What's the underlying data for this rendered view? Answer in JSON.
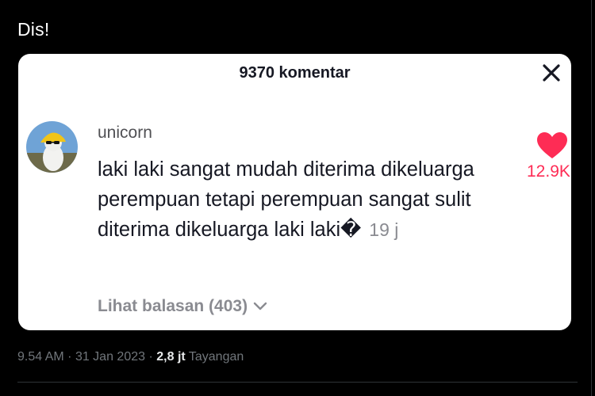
{
  "tweet": {
    "text": "Dis!",
    "time": "9.54 AM",
    "sep1": "·",
    "date": "31 Jan 2023",
    "sep2": "·",
    "views": "2,8 jt",
    "views_label": "Tayangan"
  },
  "comments_panel": {
    "title": "9370 komentar",
    "close_icon": "close-icon",
    "comment": {
      "username": "unicorn",
      "text": "laki laki sangat mudah diterima dikeluarga perempuan tetapi perempuan sangat sulit diterima dikeluarga laki laki�",
      "time_ago": "19 j",
      "likes": "12.9K",
      "like_icon": "heart-icon",
      "like_color": "#fe2c55",
      "replies_label": "Lihat balasan (403)",
      "replies_icon": "chevron-down-icon"
    }
  }
}
